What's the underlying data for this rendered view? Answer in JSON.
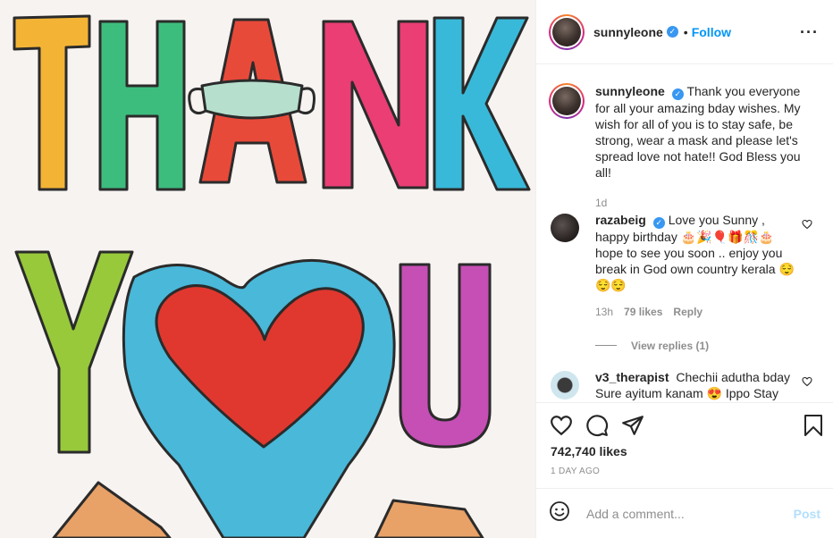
{
  "image": {
    "alt_word_1": "THANK",
    "alt_word_2": "YOU"
  },
  "header": {
    "username": "sunnyleone",
    "separator": "•",
    "follow_label": "Follow",
    "more_icon": "more-horizontal-icon"
  },
  "caption": {
    "username": "sunnyleone",
    "text": "Thank you everyone for all your amazing bday wishes. My wish for all of you is to stay safe, be strong, wear a mask and please let's spread love not hate!! God Bless you all!",
    "time": "1d"
  },
  "comments": [
    {
      "username": "razabeig",
      "verified": true,
      "text": "Love you Sunny , happy birthday 🎂🎉🎈🎁🎊🎂 hope to see you soon .. enjoy you break in God own country kerala 😌😌😌",
      "time": "13h",
      "likes": "79 likes",
      "reply_label": "Reply",
      "view_replies": "View replies (1)"
    },
    {
      "username": "v3_therapist",
      "verified": false,
      "text": "Chechii adutha bday Sure ayitum kanam 😍 Ippo Stay"
    }
  ],
  "actions": {
    "like_icon": "heart-icon",
    "comment_icon": "comment-icon",
    "share_icon": "share-icon",
    "save_icon": "bookmark-icon"
  },
  "likes_count": "742,740 likes",
  "posted_ago": "1 DAY AGO",
  "add_comment": {
    "placeholder": "Add a comment...",
    "post_label": "Post",
    "emoji_icon": "smiley-icon"
  },
  "colors": {
    "accent": "#0095f6",
    "verified": "#3897f0",
    "muted": "#8e8e8e"
  }
}
